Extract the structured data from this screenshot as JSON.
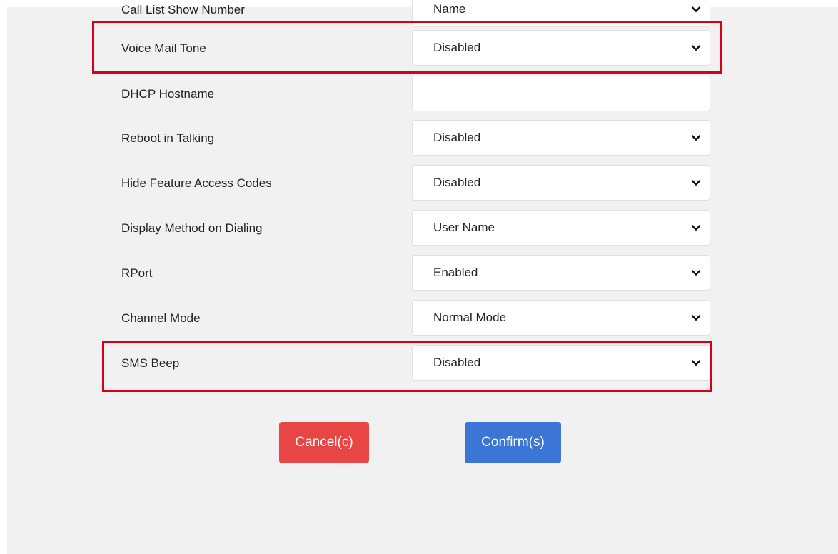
{
  "settings": {
    "rows": [
      {
        "label": "Call List Show Number",
        "value": "Name",
        "type": "select"
      },
      {
        "label": "Voice Mail Tone",
        "value": "Disabled",
        "type": "select"
      },
      {
        "label": "DHCP Hostname",
        "value": "",
        "type": "text"
      },
      {
        "label": "Reboot in Talking",
        "value": "Disabled",
        "type": "select"
      },
      {
        "label": "Hide Feature Access Codes",
        "value": "Disabled",
        "type": "select"
      },
      {
        "label": "Display Method on Dialing",
        "value": "User Name",
        "type": "select"
      },
      {
        "label": "RPort",
        "value": "Enabled",
        "type": "select"
      },
      {
        "label": "Channel Mode",
        "value": "Normal Mode",
        "type": "select"
      },
      {
        "label": "SMS Beep",
        "value": "Disabled",
        "type": "select"
      }
    ]
  },
  "actions": {
    "cancel_label": "Cancel(c)",
    "confirm_label": "Confirm(s)"
  },
  "colors": {
    "panel_bg": "#f1f1f1",
    "highlight": "#d6001c",
    "cancel": "#e84545",
    "confirm": "#3b75d6"
  },
  "icons": {
    "select_arrow": "chevron-down-icon"
  }
}
